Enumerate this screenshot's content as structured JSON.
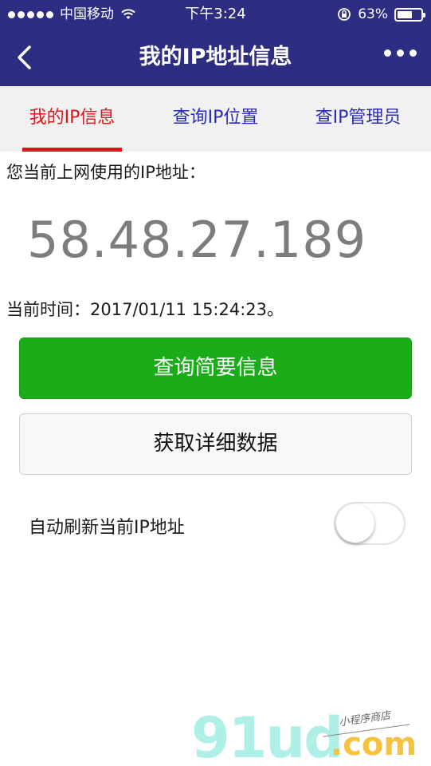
{
  "status_bar": {
    "carrier": "中国移动",
    "time": "下午3:24",
    "battery_percent": "63%",
    "battery_level": 0.63
  },
  "nav": {
    "back_icon": "chevron-left-icon",
    "title": "我的IP地址信息",
    "more_icon": "more-dots-icon"
  },
  "tabs": [
    {
      "label": "我的IP信息",
      "active": true
    },
    {
      "label": "查询IP位置",
      "active": false
    },
    {
      "label": "查IP管理员",
      "active": false
    }
  ],
  "content": {
    "ip_prompt": "您当前上网使用的IP地址：",
    "ip_address": "58.48.27.189",
    "current_time_text": "当前时间：2017/01/11 15:24:23。"
  },
  "buttons": {
    "primary_label": "查询简要信息",
    "secondary_label": "获取详细数据"
  },
  "auto_refresh": {
    "label": "自动刷新当前IP地址",
    "enabled": false
  },
  "watermark": {
    "brand_main": "91ud",
    "brand_suffix": ".com",
    "brand_tagline": "小程序商店"
  },
  "colors": {
    "nav_bg": "#2d2d82",
    "tab_active": "#e0151c",
    "tab_inactive": "#2b2bb8",
    "primary_button": "#1aad19"
  }
}
